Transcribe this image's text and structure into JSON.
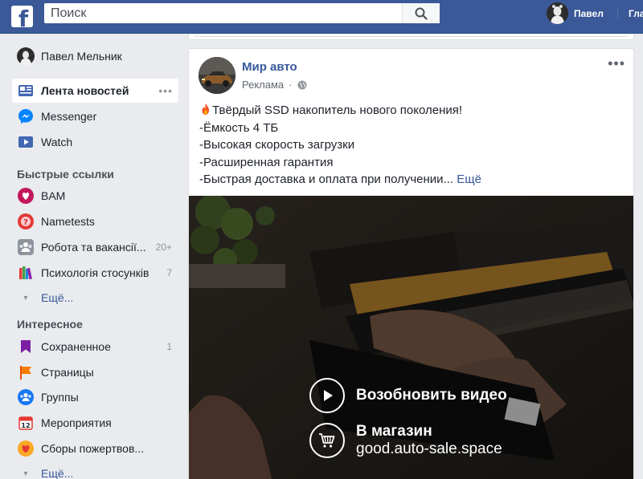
{
  "topbar": {
    "logo": "f",
    "search_placeholder": "Поиск",
    "user_name": "Павел",
    "home_label": "Главная"
  },
  "sidebar": {
    "profile_name": "Павел Мельник",
    "main_items": [
      {
        "label": "Лента новостей",
        "icon": "news-feed-icon",
        "active": true
      },
      {
        "label": "Messenger",
        "icon": "messenger-icon"
      },
      {
        "label": "Watch",
        "icon": "watch-icon"
      }
    ],
    "quick_links_title": "Быстрые ссылки",
    "quick_links": [
      {
        "label": "BAM",
        "icon": "group-avatar-icon",
        "count": ""
      },
      {
        "label": "Nametests",
        "icon": "app-avatar-icon",
        "count": ""
      },
      {
        "label": "Робота та вакансії...",
        "icon": "group-icon",
        "count": "20+"
      },
      {
        "label": "Психологія стосунків",
        "icon": "books-icon",
        "count": "7"
      }
    ],
    "more_label": "Ещё...",
    "interesting_title": "Интересное",
    "interesting": [
      {
        "label": "Сохраненное",
        "icon": "saved-icon",
        "count": "1"
      },
      {
        "label": "Страницы",
        "icon": "flag-icon",
        "count": ""
      },
      {
        "label": "Группы",
        "icon": "groups-icon",
        "count": ""
      },
      {
        "label": "Мероприятия",
        "icon": "calendar-icon",
        "count": ""
      },
      {
        "label": "Сборы пожертвов...",
        "icon": "fundraiser-icon",
        "count": ""
      }
    ],
    "more_label_2": "Ещё..."
  },
  "post": {
    "author": "Мир авто",
    "meta": "Реклама",
    "text_lines": [
      "Твёрдый SSD накопитель нового поколения!",
      "-Ёмкость 4 ТБ",
      "-Высокая скорость загрузки",
      "-Расширенная гарантия",
      "-Быстрая доставка и оплата при получении..."
    ],
    "more_link": "Ещё",
    "video": {
      "resume_label": "Возобновить видео",
      "shop_label": "В магазин",
      "shop_url": "good.auto-sale.space"
    }
  },
  "colors": {
    "brand": "#3b5998",
    "link": "#365899",
    "background": "#e9ebee"
  }
}
